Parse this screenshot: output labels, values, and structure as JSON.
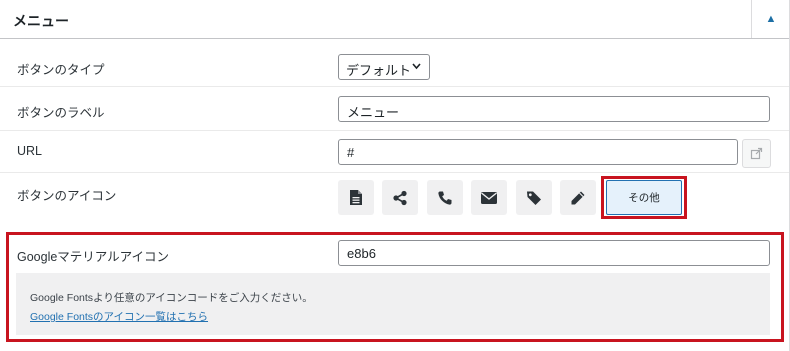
{
  "header": {
    "title": "メニュー",
    "toggle_icon": "triangle-up-icon"
  },
  "fields": {
    "button_type": {
      "label": "ボタンのタイプ",
      "value": "デフォルト"
    },
    "button_label": {
      "label": "ボタンのラベル",
      "value": "メニュー"
    },
    "url": {
      "label": "URL",
      "value": "#"
    },
    "button_icon": {
      "label": "ボタンのアイコン",
      "icons": [
        "document-icon",
        "share-icon",
        "phone-icon",
        "envelope-icon",
        "tag-icon",
        "pencil-icon"
      ],
      "other_label": "その他"
    },
    "material_icon": {
      "label": "Googleマテリアルアイコン",
      "value": "e8b6",
      "help_text": "Google Fontsより任意のアイコンコードをご入力ください。",
      "help_link": "Google Fontsのアイコン一覧はこちら"
    }
  },
  "colors": {
    "accent": "#2271b1",
    "highlight": "#c8141f"
  }
}
